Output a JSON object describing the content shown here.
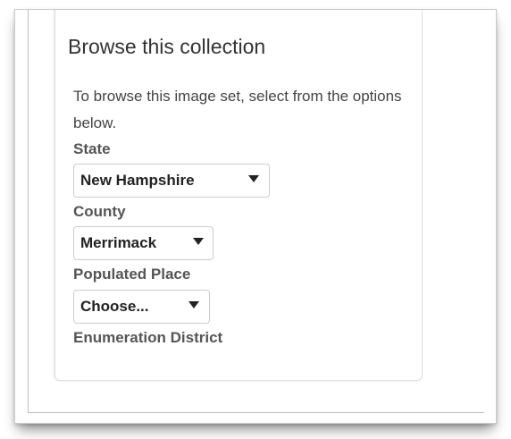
{
  "browse": {
    "title": "Browse this collection",
    "intro": "To browse this image set, select from the options below."
  },
  "filters": {
    "state": {
      "label": "State",
      "selected": "New Hampshire"
    },
    "county": {
      "label": "County",
      "selected": "Merrimack"
    },
    "populated_place": {
      "label": "Populated Place",
      "selected": "Choose..."
    },
    "enumeration_district": {
      "label": "Enumeration District"
    }
  },
  "icons": {
    "dropdown": "caret-down-icon"
  }
}
